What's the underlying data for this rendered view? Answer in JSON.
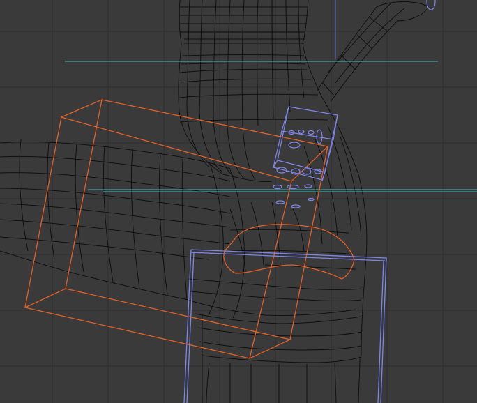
{
  "viewport": {
    "name": "3D Viewport",
    "background": "#3a3a3a",
    "grid_color": "#2f2f2f",
    "mesh_wire_color": "#101010",
    "selected_bbox_color": "#e0602a",
    "empty_bbox_color": "#7f86ea",
    "helper_line_color": "#49b6b6",
    "axis_line_color": "#5f6fd0"
  },
  "objects": [
    {
      "name": "character-mesh",
      "kind": "wireframe mesh"
    },
    {
      "name": "selected-object-bbox",
      "kind": "bounding box"
    },
    {
      "name": "small-object-cage",
      "kind": "bounding box"
    },
    {
      "name": "lower-object-cage",
      "kind": "bounding box"
    }
  ]
}
